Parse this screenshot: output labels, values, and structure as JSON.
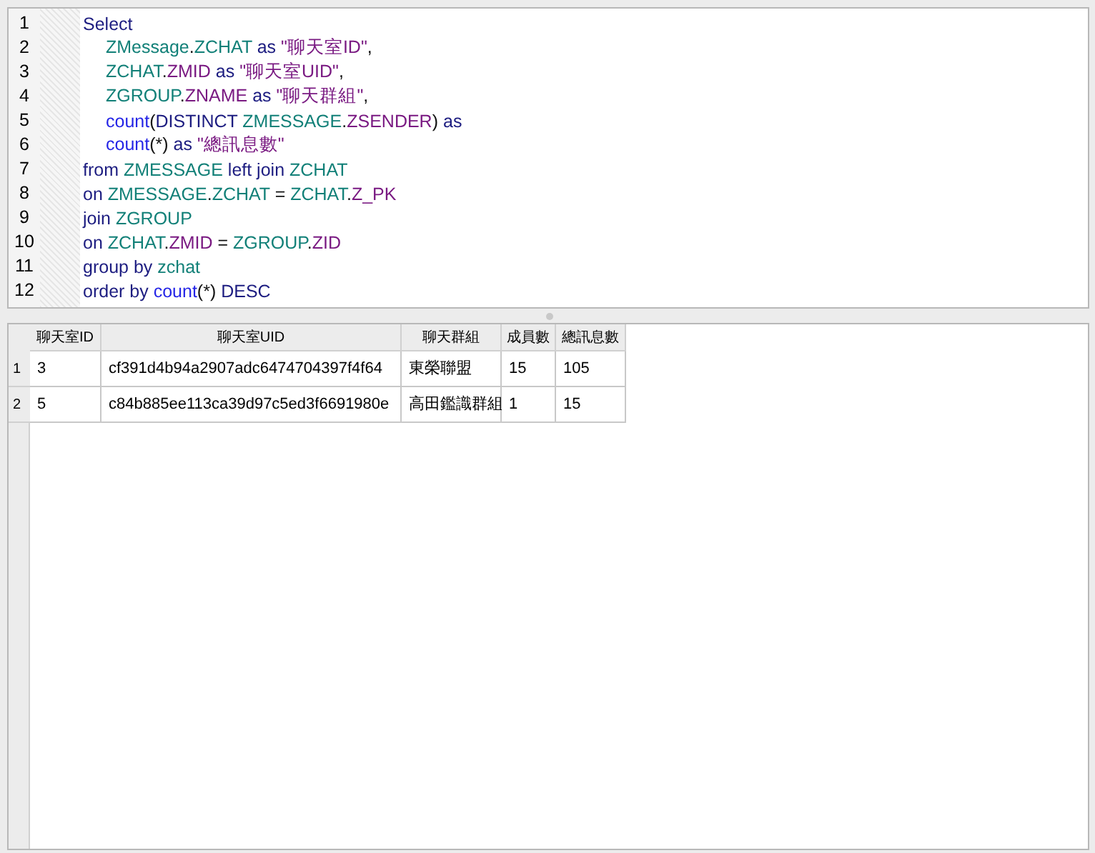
{
  "editor": {
    "lines": [
      {
        "number": "1",
        "indented": false,
        "tokens": [
          {
            "kind": "kw",
            "text": "Select"
          }
        ]
      },
      {
        "number": "2",
        "indented": true,
        "tokens": [
          {
            "kind": "id",
            "text": "ZMessage"
          },
          {
            "kind": "plain",
            "text": "."
          },
          {
            "kind": "id",
            "text": "ZCHAT"
          },
          {
            "kind": "kw",
            "text": " as"
          },
          {
            "kind": "str",
            "text": " \"聊天室ID\""
          },
          {
            "kind": "plain",
            "text": ","
          }
        ]
      },
      {
        "number": "3",
        "indented": true,
        "tokens": [
          {
            "kind": "id",
            "text": "ZCHAT"
          },
          {
            "kind": "plain",
            "text": "."
          },
          {
            "kind": "col",
            "text": "ZMID"
          },
          {
            "kind": "kw",
            "text": " as"
          },
          {
            "kind": "str",
            "text": " \"聊天室UID\""
          },
          {
            "kind": "plain",
            "text": ","
          }
        ]
      },
      {
        "number": "4",
        "indented": true,
        "tokens": [
          {
            "kind": "id",
            "text": "ZGROUP"
          },
          {
            "kind": "plain",
            "text": "."
          },
          {
            "kind": "col",
            "text": "ZNAME"
          },
          {
            "kind": "kw",
            "text": " as"
          },
          {
            "kind": "str",
            "text": " \"聊天群組\""
          },
          {
            "kind": "plain",
            "text": ","
          }
        ]
      },
      {
        "number": "5",
        "indented": true,
        "tokens": [
          {
            "kind": "fn",
            "text": "count"
          },
          {
            "kind": "plain",
            "text": "("
          },
          {
            "kind": "kw",
            "text": "DISTINCT"
          },
          {
            "kind": "id",
            "text": " ZMESSAGE"
          },
          {
            "kind": "plain",
            "text": "."
          },
          {
            "kind": "col",
            "text": "ZSENDER"
          },
          {
            "kind": "plain",
            "text": ")"
          },
          {
            "kind": "kw",
            "text": " as"
          }
        ]
      },
      {
        "number": "6",
        "indented": true,
        "tokens": [
          {
            "kind": "fn",
            "text": "count"
          },
          {
            "kind": "plain",
            "text": "(*)"
          },
          {
            "kind": "kw",
            "text": " as"
          },
          {
            "kind": "str",
            "text": " \"總訊息數\""
          }
        ]
      },
      {
        "number": "7",
        "indented": false,
        "tokens": [
          {
            "kind": "kw",
            "text": "from"
          },
          {
            "kind": "id",
            "text": " ZMESSAGE"
          },
          {
            "kind": "kw",
            "text": " left join"
          },
          {
            "kind": "id",
            "text": " ZCHAT"
          }
        ]
      },
      {
        "number": "8",
        "indented": false,
        "tokens": [
          {
            "kind": "kw",
            "text": "on"
          },
          {
            "kind": "id",
            "text": " ZMESSAGE"
          },
          {
            "kind": "plain",
            "text": "."
          },
          {
            "kind": "id",
            "text": "ZCHAT"
          },
          {
            "kind": "plain",
            "text": " = "
          },
          {
            "kind": "id",
            "text": "ZCHAT"
          },
          {
            "kind": "plain",
            "text": "."
          },
          {
            "kind": "col",
            "text": "Z_PK"
          }
        ]
      },
      {
        "number": "9",
        "indented": false,
        "tokens": [
          {
            "kind": "kw",
            "text": "join"
          },
          {
            "kind": "id",
            "text": " ZGROUP"
          }
        ]
      },
      {
        "number": "10",
        "indented": false,
        "tokens": [
          {
            "kind": "kw",
            "text": "on"
          },
          {
            "kind": "id",
            "text": " ZCHAT"
          },
          {
            "kind": "plain",
            "text": "."
          },
          {
            "kind": "col",
            "text": "ZMID"
          },
          {
            "kind": "plain",
            "text": " = "
          },
          {
            "kind": "id",
            "text": "ZGROUP"
          },
          {
            "kind": "plain",
            "text": "."
          },
          {
            "kind": "col",
            "text": "ZID"
          }
        ]
      },
      {
        "number": "11",
        "indented": false,
        "tokens": [
          {
            "kind": "kw",
            "text": "group by"
          },
          {
            "kind": "id",
            "text": " zchat"
          }
        ]
      },
      {
        "number": "12",
        "indented": false,
        "tokens": [
          {
            "kind": "kw",
            "text": "order by"
          },
          {
            "kind": "fn",
            "text": " count"
          },
          {
            "kind": "plain",
            "text": "(*)"
          },
          {
            "kind": "kw",
            "text": " DESC"
          }
        ]
      }
    ]
  },
  "results": {
    "columns": [
      "聊天室ID",
      "聊天室UID",
      "聊天群組",
      "成員數",
      "總訊息數"
    ],
    "rows": [
      {
        "number": "1",
        "cells": [
          "3",
          "cf391d4b94a2907adc6474704397f4f64",
          "東榮聯盟",
          "15",
          "105"
        ]
      },
      {
        "number": "2",
        "cells": [
          "5",
          "c84b885ee113ca39d97c5ed3f6691980e",
          "高田鑑識群組",
          "1",
          "15"
        ]
      }
    ]
  }
}
